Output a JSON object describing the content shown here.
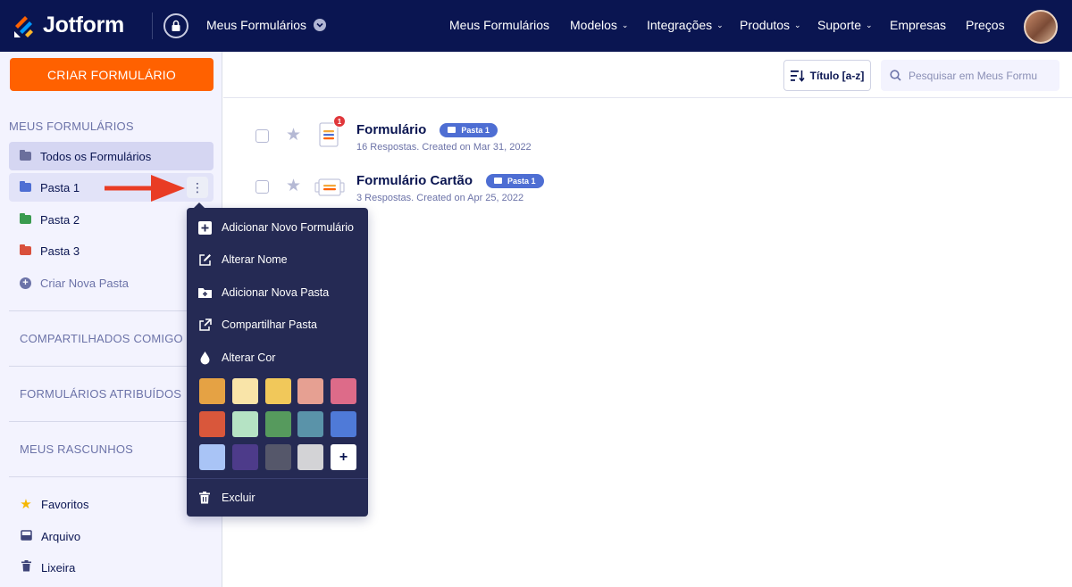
{
  "header": {
    "logo_text": "Jotform",
    "my_forms_label": "Meus Formulários",
    "nav": [
      {
        "label": "Meus Formulários",
        "caret": ""
      },
      {
        "label": "Modelos",
        "caret": "⌄"
      },
      {
        "label": "Integrações",
        "caret": "⌄"
      },
      {
        "label": "Produtos",
        "caret": "⌄"
      },
      {
        "label": "Suporte",
        "caret": "⌄"
      },
      {
        "label": "Empresas",
        "caret": ""
      },
      {
        "label": "Preços",
        "caret": ""
      }
    ]
  },
  "sidebar": {
    "create_button": "CRIAR FORMULÁRIO",
    "my_forms_title": "MEUS FORMULÁRIOS",
    "items": [
      {
        "label": "Todos os Formulários",
        "color": "#6b6f9c"
      },
      {
        "label": "Pasta 1",
        "color": "#4e6ed3"
      },
      {
        "label": "Pasta 2",
        "color": "#3a9b4f"
      },
      {
        "label": "Pasta 3",
        "color": "#d9503c"
      }
    ],
    "create_folder": "Criar Nova Pasta",
    "shared_title": "COMPARTILHADOS COMIGO",
    "assigned_title": "FORMULÁRIOS ATRIBUÍDOS",
    "drafts_title": "MEUS RASCUNHOS",
    "bottom": [
      {
        "label": "Favoritos",
        "icon": "star-icon"
      },
      {
        "label": "Arquivo",
        "icon": "archive-icon"
      },
      {
        "label": "Lixeira",
        "icon": "trash-icon"
      }
    ]
  },
  "toolbar": {
    "sort_label": "Título [a-z]",
    "search_placeholder": "Pesquisar em Meus Formu"
  },
  "forms": [
    {
      "title": "Formulário",
      "folder": "Pasta 1",
      "subtitle": "16 Respostas. Created on Mar 31, 2022",
      "badge": "1"
    },
    {
      "title": "Formulário Cartão",
      "folder": "Pasta 1",
      "subtitle": "3 Respostas. Created on Apr 25, 2022",
      "badge": ""
    }
  ],
  "context_menu": {
    "items": [
      {
        "label": "Adicionar Novo Formulário",
        "icon": "plus-square-icon"
      },
      {
        "label": "Alterar Nome",
        "icon": "edit-icon"
      },
      {
        "label": "Adicionar Nova Pasta",
        "icon": "add-folder-icon"
      },
      {
        "label": "Compartilhar Pasta",
        "icon": "share-icon"
      },
      {
        "label": "Alterar Cor",
        "icon": "drop-icon"
      }
    ],
    "colors": [
      "#e5a244",
      "#f9e4a8",
      "#f1c85a",
      "#e6a092",
      "#dd6b89",
      "#d9573b",
      "#b5e3c4",
      "#569a5d",
      "#5a93a9",
      "#4f7ad8",
      "#a9c4f6",
      "#4d3b8a",
      "#55576a",
      "#d3d3d6"
    ],
    "add_color_label": "+",
    "delete_label": "Excluir"
  },
  "accent_colors": {
    "brand_navy": "#0a1551",
    "brand_orange": "#ff6100",
    "pill_blue": "#4e6ed3"
  }
}
